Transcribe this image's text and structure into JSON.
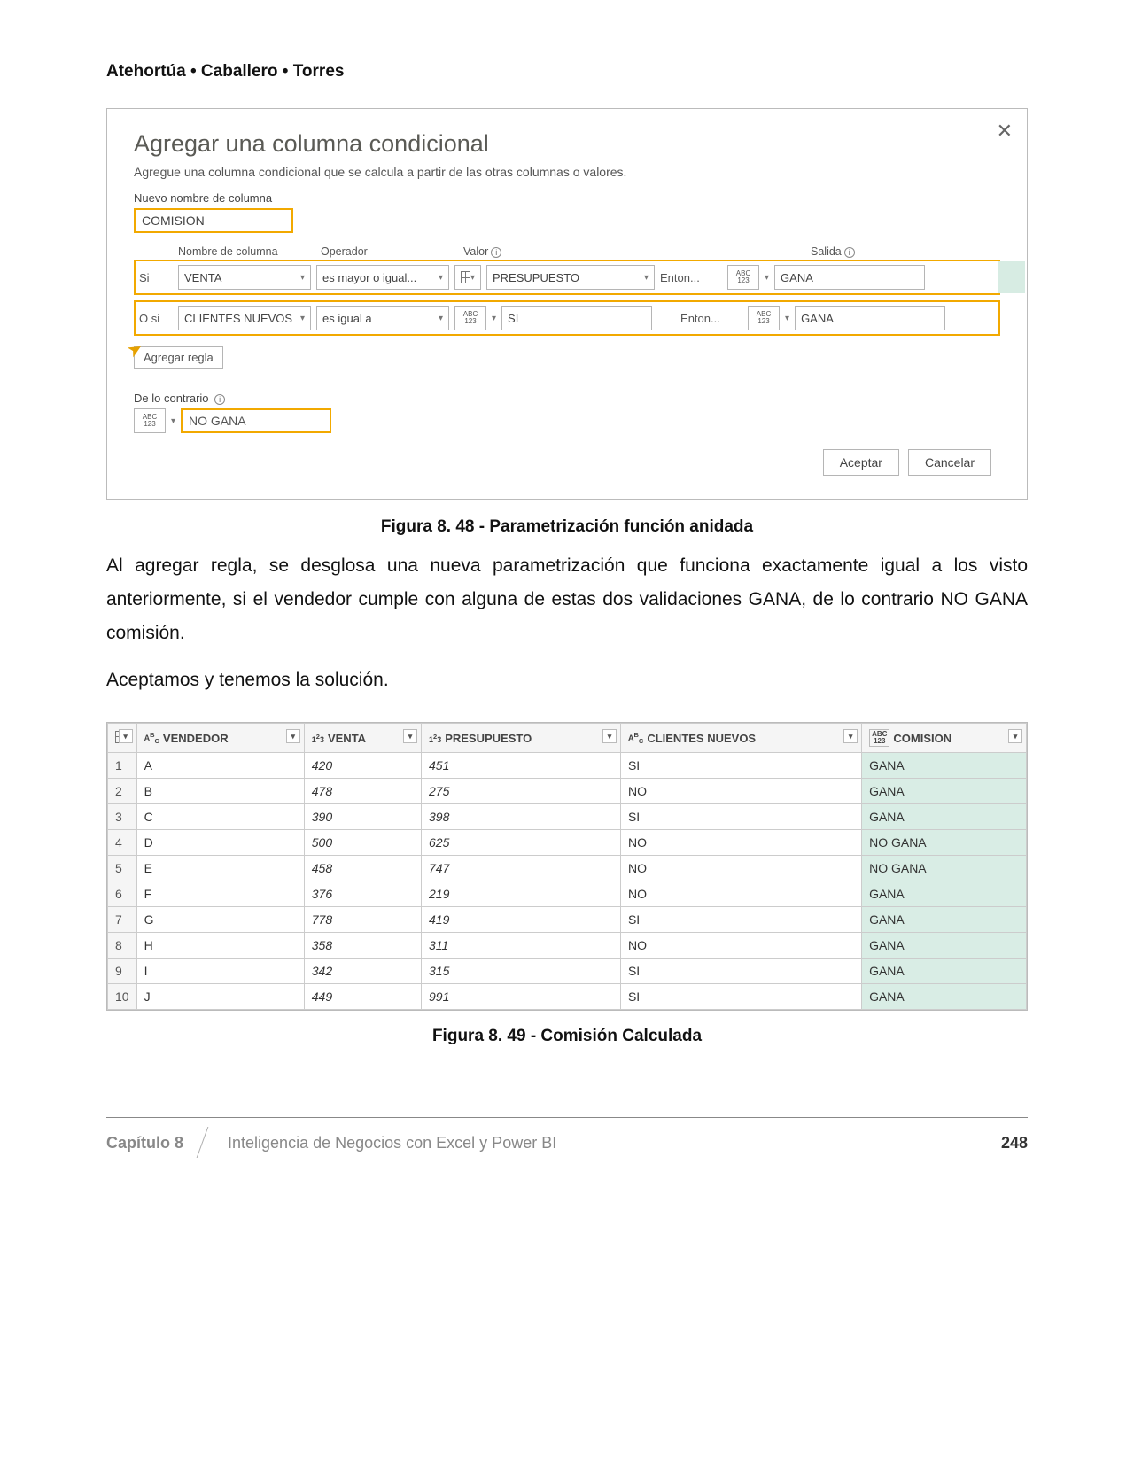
{
  "authors": "Atehortúa • Caballero • Torres",
  "dialog": {
    "title": "Agregar una columna condicional",
    "subtitle": "Agregue una columna condicional que se calcula a partir de las otras columnas o valores.",
    "new_col_label": "Nuevo nombre de columna",
    "new_col_value": "COMISION",
    "headers": {
      "col": "Nombre de columna",
      "op": "Operador",
      "val": "Valor",
      "out": "Salida"
    },
    "rules": [
      {
        "prefix": "Si",
        "column": "VENTA",
        "operator": "es mayor o igual...",
        "value": "PRESUPUESTO",
        "then": "Enton...",
        "output": "GANA",
        "icon": "grid"
      },
      {
        "prefix": "O si",
        "column": "CLIENTES NUEVOS",
        "operator": "es igual a",
        "value": "SI",
        "then": "Enton...",
        "output": "GANA",
        "icon": "abc"
      }
    ],
    "add_rule": "Agregar regla",
    "otherwise_label": "De lo contrario",
    "otherwise_value": "NO GANA",
    "accept": "Aceptar",
    "cancel": "Cancelar"
  },
  "caption1": "Figura 8. 48 - Parametrización función anidada",
  "para1": "Al agregar regla, se desglosa una nueva parametrización que funciona exactamente igual a los visto  anteriormente, si el vendedor cumple con alguna de estas dos validaciones GANA, de lo contrario NO GANA comisión.",
  "para2": "Aceptamos y tenemos la solución.",
  "table": {
    "columns": [
      "VENDEDOR",
      "VENTA",
      "PRESUPUESTO",
      "CLIENTES NUEVOS",
      "COMISION"
    ],
    "rows": [
      {
        "idx": 1,
        "vend": "A",
        "venta": 420,
        "pres": 451,
        "clientes": "SI",
        "com": "GANA"
      },
      {
        "idx": 2,
        "vend": "B",
        "venta": 478,
        "pres": 275,
        "clientes": "NO",
        "com": "GANA"
      },
      {
        "idx": 3,
        "vend": "C",
        "venta": 390,
        "pres": 398,
        "clientes": "SI",
        "com": "GANA"
      },
      {
        "idx": 4,
        "vend": "D",
        "venta": 500,
        "pres": 625,
        "clientes": "NO",
        "com": "NO GANA"
      },
      {
        "idx": 5,
        "vend": "E",
        "venta": 458,
        "pres": 747,
        "clientes": "NO",
        "com": "NO GANA"
      },
      {
        "idx": 6,
        "vend": "F",
        "venta": 376,
        "pres": 219,
        "clientes": "NO",
        "com": "GANA"
      },
      {
        "idx": 7,
        "vend": "G",
        "venta": 778,
        "pres": 419,
        "clientes": "SI",
        "com": "GANA"
      },
      {
        "idx": 8,
        "vend": "H",
        "venta": 358,
        "pres": 311,
        "clientes": "NO",
        "com": "GANA"
      },
      {
        "idx": 9,
        "vend": "I",
        "venta": 342,
        "pres": 315,
        "clientes": "SI",
        "com": "GANA"
      },
      {
        "idx": 10,
        "vend": "J",
        "venta": 449,
        "pres": 991,
        "clientes": "SI",
        "com": "GANA"
      }
    ]
  },
  "caption2": "Figura 8. 49 - Comisión Calculada",
  "footer": {
    "chapter": "Capítulo 8",
    "title": "Inteligencia de Negocios con Excel y Power BI",
    "page": "248"
  }
}
